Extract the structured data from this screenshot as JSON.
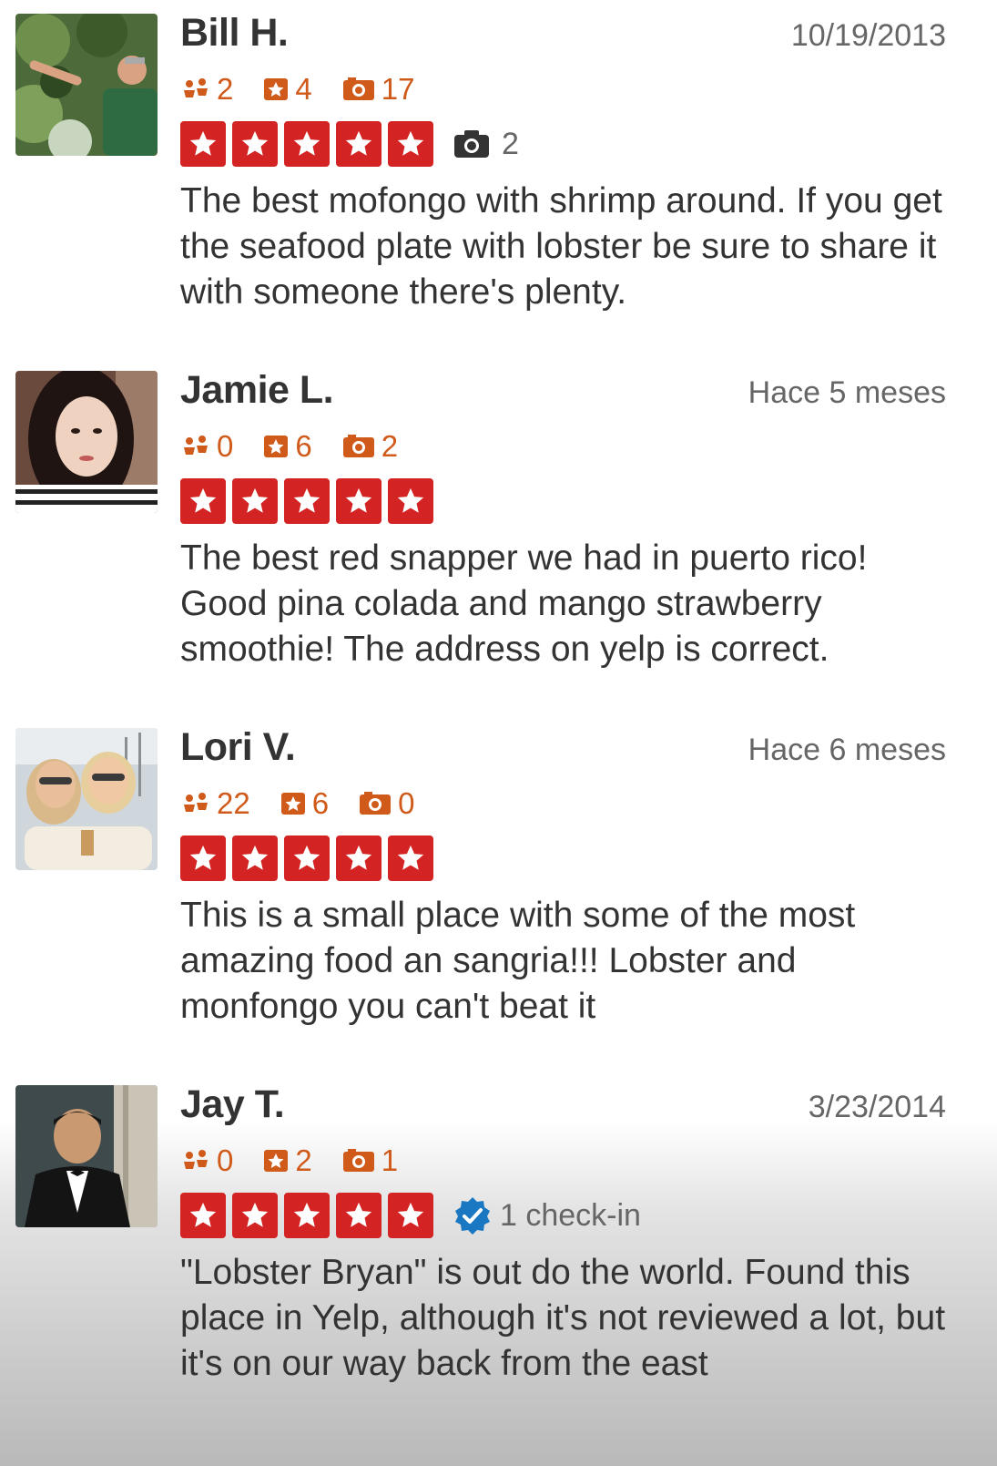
{
  "colors": {
    "star_red": "#d32323",
    "stat_orange": "#d05a19",
    "verified_blue": "#1a78c2"
  },
  "reviews": [
    {
      "name": "Bill H.",
      "date": "10/19/2013",
      "friends": "2",
      "reviews_count": "4",
      "photos_count": "17",
      "stars": 5,
      "badge": {
        "icon": "camera-icon",
        "text": "2"
      },
      "text": "The best mofongo with shrimp around. If you get the seafood plate with lobster be sure to share it with someone there's plenty."
    },
    {
      "name": "Jamie L.",
      "date": "Hace 5 meses",
      "friends": "0",
      "reviews_count": "6",
      "photos_count": "2",
      "stars": 5,
      "text": "The best red snapper we had in puerto rico! Good pina colada and mango strawberry smoothie! The address on yelp is correct."
    },
    {
      "name": "Lori V.",
      "date": "Hace 6 meses",
      "friends": "22",
      "reviews_count": "6",
      "photos_count": "0",
      "stars": 5,
      "text": "This is a small place with some of the most amazing food an sangria!!! Lobster and monfongo you can't beat it"
    },
    {
      "name": "Jay T.",
      "date": "3/23/2014",
      "friends": "0",
      "reviews_count": "2",
      "photos_count": "1",
      "stars": 5,
      "badge": {
        "icon": "verified-check-icon",
        "text": "1 check-in"
      },
      "text": "\"Lobster Bryan\"  is out do the world.  Found this place in Yelp, although it's not reviewed a lot, but it's on our way back from the east"
    }
  ]
}
